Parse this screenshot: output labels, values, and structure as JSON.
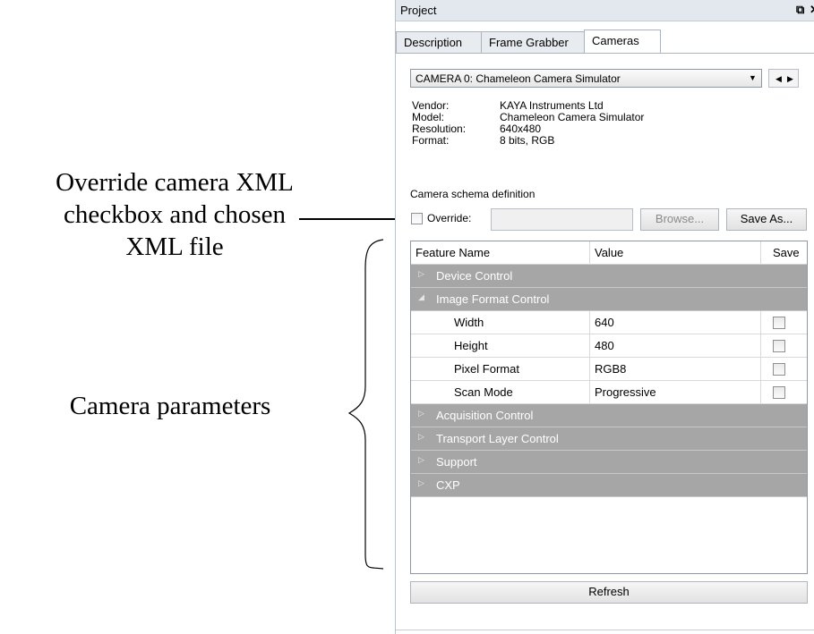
{
  "annotations": {
    "override_line1": "Override camera XML",
    "override_line2": "checkbox and chosen",
    "override_line3": "XML file",
    "params": "Camera parameters"
  },
  "panel": {
    "title": "Project",
    "controls": {
      "restore_icon": "restore-window-icon",
      "close_icon": "close-icon"
    },
    "tabs": [
      {
        "label": "Description",
        "active": false
      },
      {
        "label": "Frame Grabber",
        "active": false
      },
      {
        "label": "Cameras",
        "active": true
      }
    ],
    "camera_select": {
      "value": "CAMERA 0: Chameleon Camera Simulator"
    },
    "info": [
      {
        "label": "Vendor:",
        "value": "KAYA Instruments Ltd"
      },
      {
        "label": "Model:",
        "value": "Chameleon Camera Simulator"
      },
      {
        "label": "Resolution:",
        "value": "640x480"
      },
      {
        "label": "Format:",
        "value": "8 bits, RGB"
      }
    ],
    "schema_title": "Camera schema definition",
    "override_label": "Override:",
    "override_checked": false,
    "xml_file_value": "",
    "browse_label": "Browse...",
    "save_as_label": "Save As...",
    "grid": {
      "headers": {
        "name": "Feature Name",
        "value": "Value",
        "save": "Save"
      },
      "rows": [
        {
          "type": "category",
          "name": "Device Control",
          "expanded": false
        },
        {
          "type": "category",
          "name": "Image Format Control",
          "expanded": true
        },
        {
          "type": "feature",
          "name": "Width",
          "value": "640",
          "save": false
        },
        {
          "type": "feature",
          "name": "Height",
          "value": "480",
          "save": false
        },
        {
          "type": "feature",
          "name": "Pixel Format",
          "value": "RGB8",
          "save": false
        },
        {
          "type": "feature",
          "name": "Scan Mode",
          "value": "Progressive",
          "save": false
        },
        {
          "type": "category",
          "name": "Acquisition Control",
          "expanded": false
        },
        {
          "type": "category",
          "name": "Transport Layer Control",
          "expanded": false
        },
        {
          "type": "category",
          "name": "Support",
          "expanded": false
        },
        {
          "type": "category",
          "name": "CXP",
          "expanded": false
        }
      ]
    },
    "refresh_label": "Refresh"
  }
}
